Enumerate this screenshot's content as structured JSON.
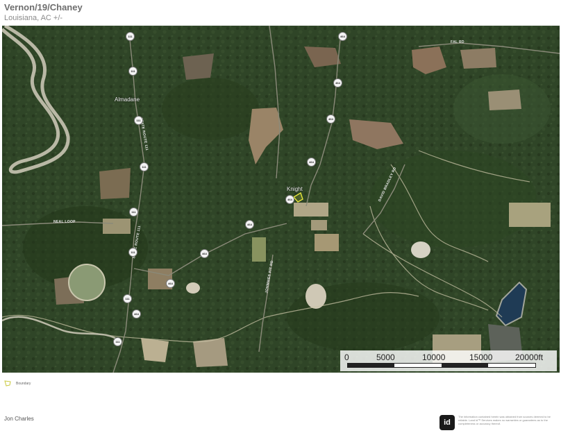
{
  "header": {
    "title": "Vernon/19/Chaney",
    "subtitle": "Louisiana,  AC +/-"
  },
  "map": {
    "places": [
      {
        "name": "Almadane"
      },
      {
        "name": "Knight"
      }
    ],
    "roads": [
      {
        "name": "NEAL LOOP"
      },
      {
        "name": "STATE ROUTE 111"
      },
      {
        "name": "STATE ROUTE 111"
      },
      {
        "name": "JOHNNIES PIT RD"
      },
      {
        "name": "DAVID BRADLEY RD"
      },
      {
        "name": "FAL RD"
      }
    ],
    "shields": [
      "111",
      "111",
      "111",
      "111",
      "111",
      "111",
      "111",
      "111",
      "464",
      "464",
      "464",
      "464",
      "464",
      "464",
      "464",
      "464",
      "464"
    ],
    "scale": {
      "labels": [
        "0",
        "5000",
        "10000",
        "15000",
        "20000ft"
      ]
    },
    "colors": {
      "forest": "#2f4527",
      "river": "#b9b8a5",
      "boundary": "#e6e63a"
    }
  },
  "legend": {
    "label": "Boundary",
    "color": "#e6e63a"
  },
  "footer": {
    "name": "Jon Charles",
    "brand": "id",
    "disclaimer": "The information contained herein was obtained from sources deemed to be reliable. Land id™ Services makes no warranties or guarantees as to the completeness or accuracy thereof."
  }
}
